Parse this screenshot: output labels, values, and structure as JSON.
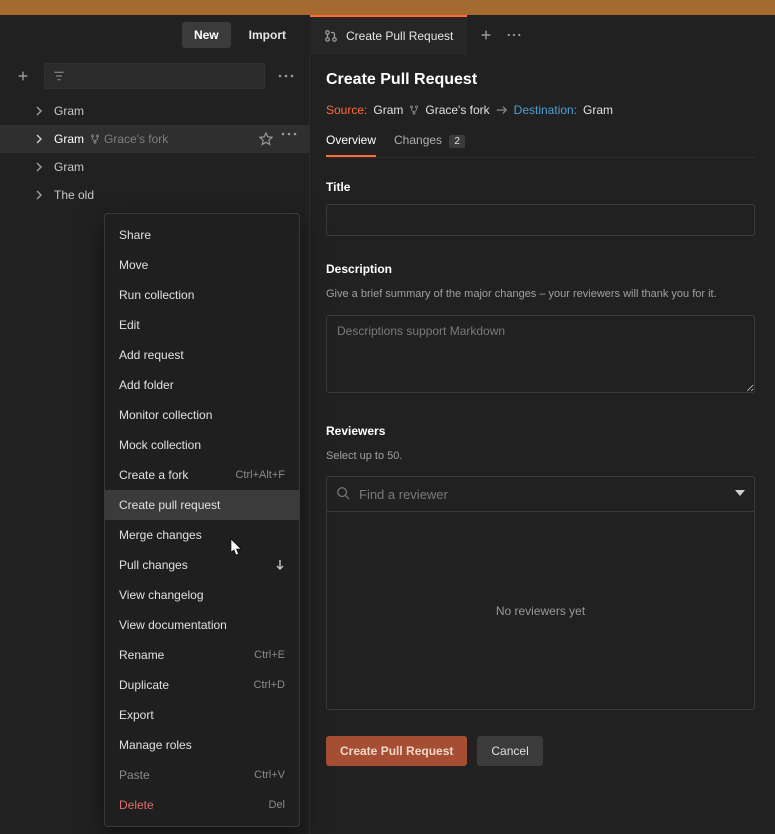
{
  "toolbar": {
    "new_label": "New",
    "import_label": "Import"
  },
  "tabs": {
    "active": "Create Pull Request"
  },
  "sidebar": {
    "items": [
      {
        "label": "Gram",
        "sub": "",
        "selected": false
      },
      {
        "label": "Gram",
        "sub": "Grace's fork",
        "selected": true
      },
      {
        "label": "Gram",
        "sub": "",
        "selected": false
      },
      {
        "label": "The old",
        "sub": "",
        "selected": false
      }
    ]
  },
  "context_menu": {
    "items": [
      {
        "label": "Share",
        "shortcut": "",
        "highlight": false
      },
      {
        "label": "Move",
        "shortcut": "",
        "highlight": false
      },
      {
        "label": "Run collection",
        "shortcut": "",
        "highlight": false
      },
      {
        "label": "Edit",
        "shortcut": "",
        "highlight": false
      },
      {
        "label": "Add request",
        "shortcut": "",
        "highlight": false
      },
      {
        "label": "Add folder",
        "shortcut": "",
        "highlight": false
      },
      {
        "label": "Monitor collection",
        "shortcut": "",
        "highlight": false
      },
      {
        "label": "Mock collection",
        "shortcut": "",
        "highlight": false
      },
      {
        "label": "Create a fork",
        "shortcut": "Ctrl+Alt+F",
        "highlight": false
      },
      {
        "label": "Create pull request",
        "shortcut": "",
        "highlight": true
      },
      {
        "label": "Merge changes",
        "shortcut": "",
        "highlight": false
      },
      {
        "label": "Pull changes",
        "shortcut": "",
        "highlight": false,
        "icon": "down-arrow"
      },
      {
        "label": "View changelog",
        "shortcut": "",
        "highlight": false
      },
      {
        "label": "View documentation",
        "shortcut": "",
        "highlight": false
      },
      {
        "label": "Rename",
        "shortcut": "Ctrl+E",
        "highlight": false
      },
      {
        "label": "Duplicate",
        "shortcut": "Ctrl+D",
        "highlight": false
      },
      {
        "label": "Export",
        "shortcut": "",
        "highlight": false
      },
      {
        "label": "Manage roles",
        "shortcut": "",
        "highlight": false
      },
      {
        "label": "Paste",
        "shortcut": "Ctrl+V",
        "highlight": false,
        "dim": true
      },
      {
        "label": "Delete",
        "shortcut": "Del",
        "highlight": false,
        "danger": true
      }
    ]
  },
  "page": {
    "heading": "Create Pull Request",
    "source_label": "Source:",
    "source_value": "Gram",
    "source_fork": "Grace's fork",
    "dest_label": "Destination:",
    "dest_value": "Gram",
    "tabs": {
      "overview": "Overview",
      "changes": "Changes",
      "changes_count": "2"
    },
    "title_label": "Title",
    "description_label": "Description",
    "description_help": "Give a brief summary of the major changes – your reviewers will thank you for it.",
    "description_placeholder": "Descriptions support Markdown",
    "reviewers_label": "Reviewers",
    "reviewers_help": "Select up to 50.",
    "reviewer_search_placeholder": "Find a reviewer",
    "reviewers_empty": "No reviewers yet",
    "submit_label": "Create Pull Request",
    "cancel_label": "Cancel"
  }
}
